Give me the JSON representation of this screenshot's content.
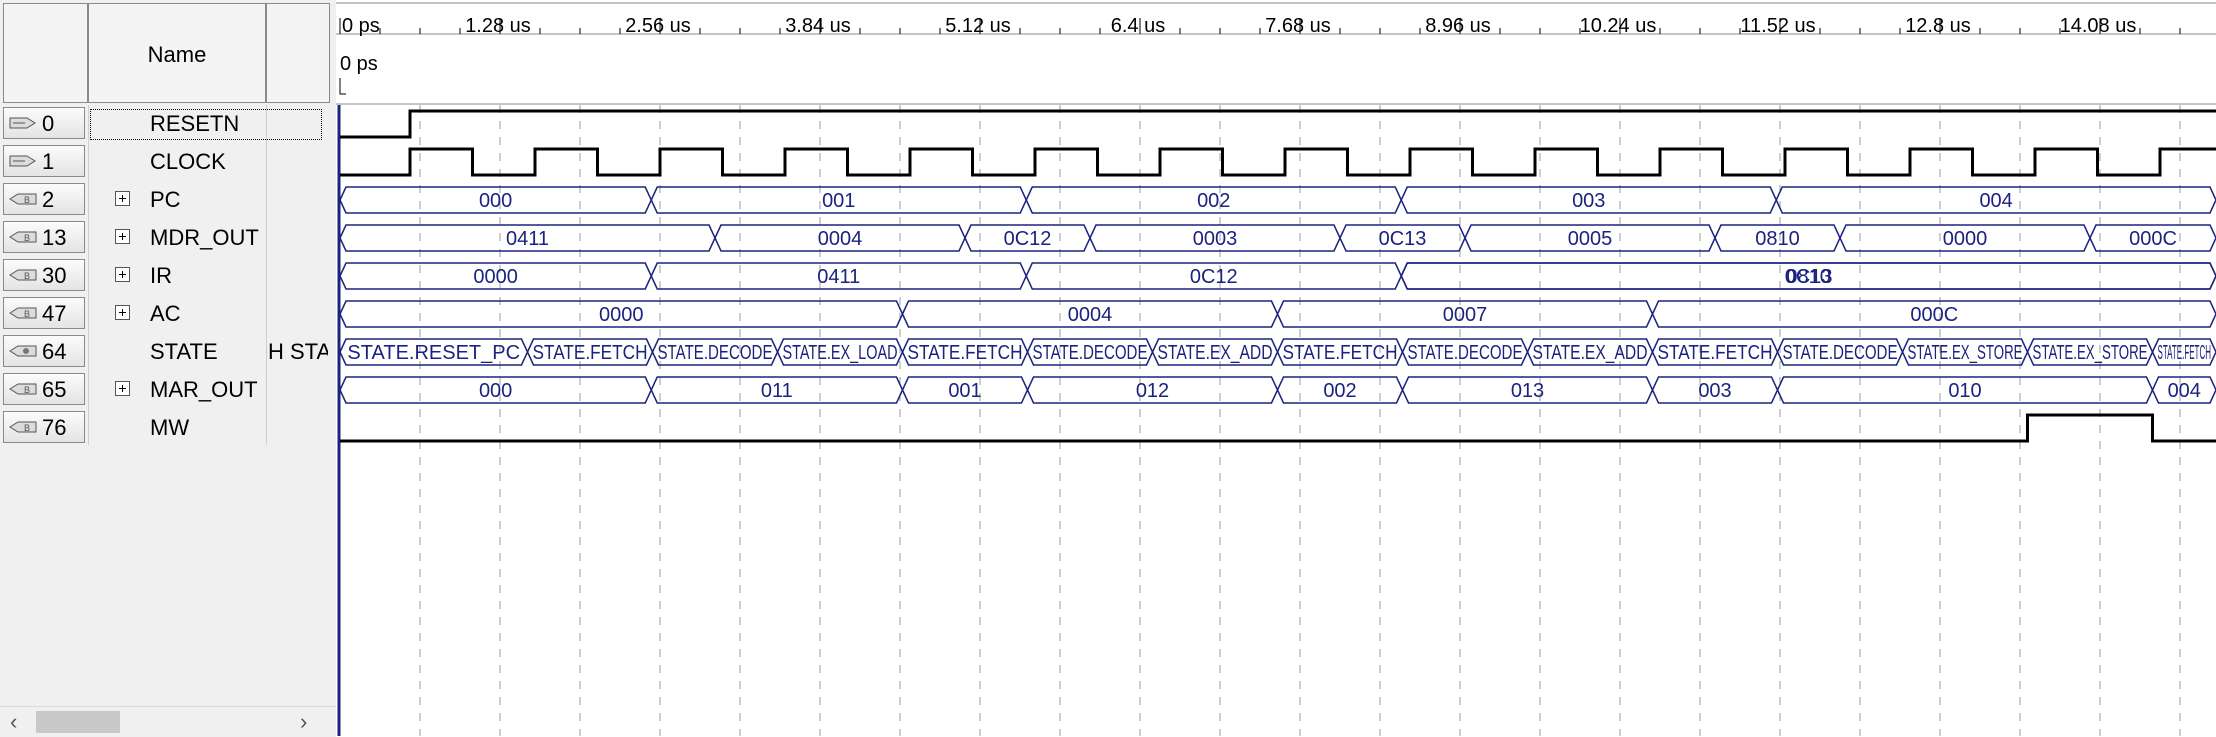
{
  "header": {
    "name_label": "Name"
  },
  "time_axis": {
    "ticks": [
      "0 ps",
      "1.28 us",
      "2.56 us",
      "3.84 us",
      "5.12 us",
      "6.4 us",
      "7.68 us",
      "8.96 us",
      "10.24 us",
      "11.52 us",
      "12.8 us",
      "14.08 us"
    ],
    "cursor_label": "0 ps"
  },
  "signals": [
    {
      "index": "0",
      "name": "RESETN",
      "kind": "input",
      "expandable": false,
      "value": ""
    },
    {
      "index": "1",
      "name": "CLOCK",
      "kind": "input",
      "expandable": false,
      "value": ""
    },
    {
      "index": "2",
      "name": "PC",
      "kind": "output",
      "expandable": true,
      "value": ""
    },
    {
      "index": "13",
      "name": "MDR_OUT",
      "kind": "output",
      "expandable": true,
      "value": ""
    },
    {
      "index": "30",
      "name": "IR",
      "kind": "output",
      "expandable": true,
      "value": ""
    },
    {
      "index": "47",
      "name": "AC",
      "kind": "output",
      "expandable": true,
      "value": ""
    },
    {
      "index": "64",
      "name": "STATE",
      "kind": "state",
      "expandable": false,
      "value": "H STATE"
    },
    {
      "index": "65",
      "name": "MAR_OUT",
      "kind": "output",
      "expandable": true,
      "value": ""
    },
    {
      "index": "76",
      "name": "MW",
      "kind": "output",
      "expandable": false,
      "value": ""
    }
  ],
  "waves": {
    "RESETN": {
      "type": "bit",
      "times": [
        0,
        0.56
      ],
      "levels": [
        0,
        1
      ]
    },
    "CLOCK": {
      "type": "clock",
      "first_high": 0.56,
      "half_period": 0.5,
      "start_level": 0
    },
    "PC": {
      "type": "bus",
      "changes": [
        0,
        2.49,
        5.49,
        8.49,
        11.49
      ],
      "labels": [
        "000",
        "001",
        "002",
        "003",
        "004"
      ]
    },
    "MDR_OUT": {
      "type": "bus",
      "changes": [
        0,
        3.0,
        5.0,
        6.0,
        8.0,
        9.0,
        11.0,
        12.0,
        14.0
      ],
      "labels": [
        "0411",
        "0004",
        "0C12",
        "0003",
        "0C13",
        "0005",
        "0810",
        "0000",
        "000C"
      ]
    },
    "IR": {
      "type": "bus",
      "changes": [
        0,
        2.49,
        5.49,
        8.49
      ],
      "labels": [
        "0000",
        "0411",
        "0C12",
        "0C13",
        "0810"
      ]
    },
    "AC": {
      "type": "bus",
      "changes": [
        0,
        4.5,
        7.5,
        10.5
      ],
      "labels": [
        "0000",
        "0004",
        "0007",
        "000C"
      ]
    },
    "STATE": {
      "type": "bus",
      "changes": [
        0,
        1.5,
        2.5,
        3.5,
        4.5,
        5.5,
        6.5,
        7.5,
        8.5,
        9.5,
        10.5,
        11.5,
        12.5,
        13.5,
        14.5
      ],
      "labels": [
        "STATE.RESET_PC",
        "STATE.FETCH",
        "STATE.DECODE",
        "STATE.EX_LOAD",
        "STATE.FETCH",
        "STATE.DECODE",
        "STATE.EX_ADD",
        "STATE.FETCH",
        "STATE.DECODE",
        "STATE.EX_ADD",
        "STATE.FETCH",
        "STATE.DECODE",
        "STATE.EX_STORE",
        "STATE.EX_STORE",
        "STATE.FETCH"
      ]
    },
    "MAR_OUT": {
      "type": "bus",
      "changes": [
        0,
        2.49,
        4.5,
        5.5,
        7.5,
        8.5,
        10.5,
        11.5,
        14.5
      ],
      "labels": [
        "000",
        "011",
        "001",
        "012",
        "002",
        "013",
        "003",
        "010",
        "004"
      ]
    },
    "MW": {
      "type": "bit",
      "times": [
        0,
        13.5,
        14.5
      ],
      "levels": [
        0,
        1,
        0
      ]
    }
  },
  "colors": {
    "bus": "#1a237e",
    "bit": "#000000",
    "grid": "#9e9e9e",
    "panel": "#f0f0f0",
    "cursor": "#1a237e"
  }
}
